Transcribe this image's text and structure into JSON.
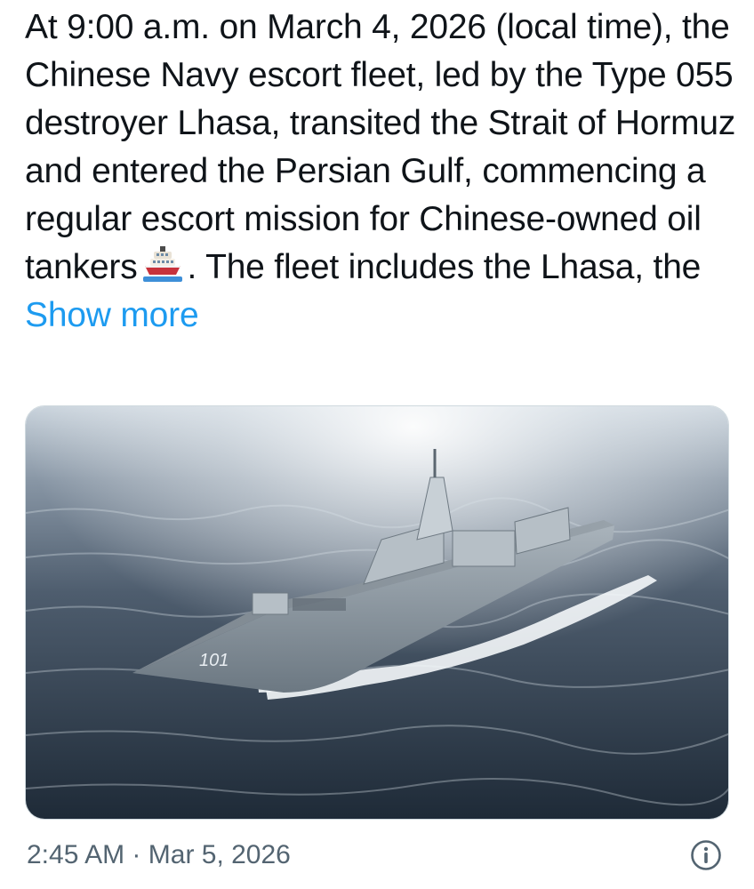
{
  "post": {
    "text_before_emoji": "At 9:00 a.m. on March 4, 2026 (local time), the Chinese Navy escort fleet, led by the Type 055 destroyer Lhasa, transited the Strait of Hormuz and entered the Persian Gulf, commencing a regular escort mission for Chinese-owned oil tankers",
    "emoji_icon": "ship-icon",
    "text_after_emoji": ". The fleet includes the Lhasa, the",
    "show_more_label": "Show more",
    "hull_number": "101",
    "timestamp": "2:45 AM",
    "separator": "·",
    "date": "Mar 5, 2026",
    "info_icon": "info-icon"
  },
  "colors": {
    "text": "#0f1419",
    "link": "#1d9bf0",
    "meta": "#536471",
    "sea_dark": "#2b3848",
    "sea_light": "#dfe6ec",
    "ship_hull": "#8f9aa4"
  }
}
